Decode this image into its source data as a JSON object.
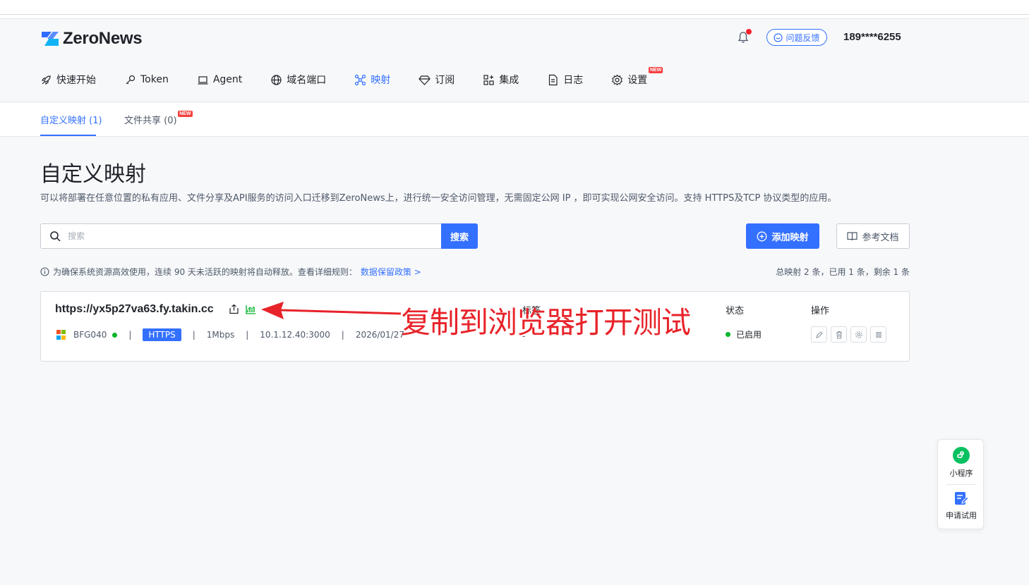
{
  "app": {
    "brand": "ZeroNews",
    "feedback_label": "问题反馈",
    "user_phone": "189****6255"
  },
  "nav": {
    "items": [
      {
        "label": "快速开始",
        "icon": "rocket-icon"
      },
      {
        "label": "Token",
        "icon": "key-icon"
      },
      {
        "label": "Agent",
        "icon": "laptop-icon"
      },
      {
        "label": "域名端口",
        "icon": "globe-icon"
      },
      {
        "label": "映射",
        "icon": "network-icon",
        "active": true
      },
      {
        "label": "订阅",
        "icon": "diamond-icon"
      },
      {
        "label": "集成",
        "icon": "apps-icon"
      },
      {
        "label": "日志",
        "icon": "file-icon"
      },
      {
        "label": "设置",
        "icon": "gear-icon",
        "badge": "NEW"
      }
    ]
  },
  "subtabs": [
    {
      "label": "自定义映射 (1)",
      "active": true
    },
    {
      "label": "文件共享 (0)",
      "badge": "NEW"
    }
  ],
  "page": {
    "title": "自定义映射",
    "description": "可以将部署在任意位置的私有应用、文件分享及API服务的访问入口迁移到ZeroNews上，进行统一安全访问管理，无需固定公网 IP ，即可实现公网安全访问。支持 HTTPS及TCP 协议类型的应用。"
  },
  "search": {
    "placeholder": "搜索",
    "button_label": "搜索"
  },
  "actions": {
    "add_label": "添加映射",
    "docs_label": "参考文档"
  },
  "notice": {
    "text": "为确保系统资源高效使用，连续 90 天未活跃的映射将自动释放。查看详细规则：",
    "link_label": "数据保留政策 >"
  },
  "summary": "总映射 2 条，已用 1 条，剩余 1 条",
  "mapping": {
    "url": "https://yx5p27va63.fy.takin.cc",
    "agent": "BFG040",
    "protocol": "HTTPS",
    "bandwidth": "1Mbps",
    "target": "10.1.12.40:3000",
    "date": "2026/01/27",
    "tag_header": "标签",
    "tag_value": "-",
    "status_header": "状态",
    "status_value": "已启用",
    "ops_header": "操作"
  },
  "annotation": "复制到浏览器打开测试",
  "float_panel": {
    "miniapp_label": "小程序",
    "trial_label": "申请试用"
  },
  "colors": {
    "accent": "#3370ff",
    "annotation": "#e8232a",
    "status_green": "#00b42a"
  }
}
